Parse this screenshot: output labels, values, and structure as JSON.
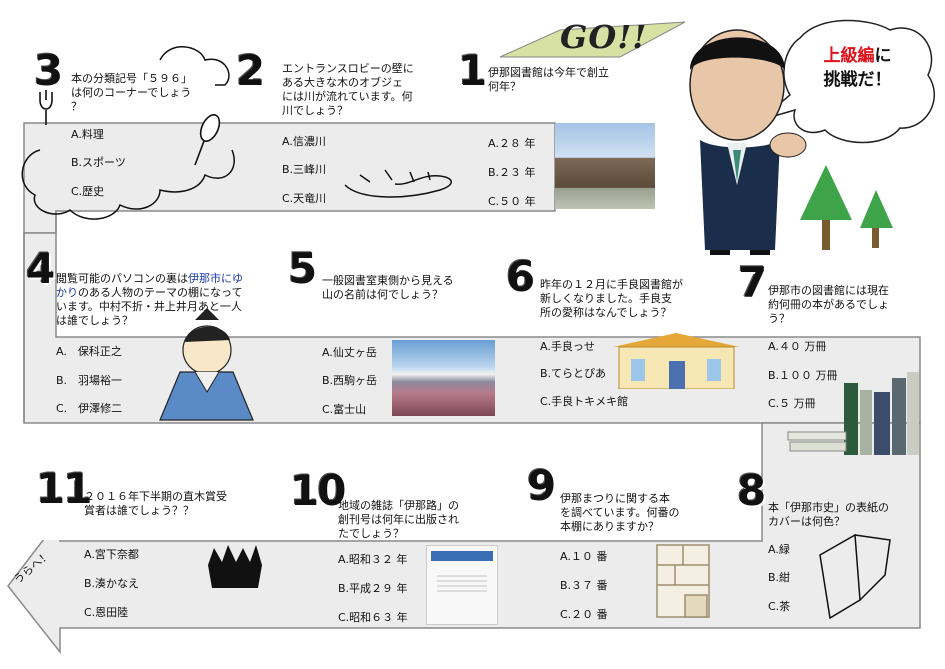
{
  "header": {
    "go": "GO!!",
    "bubble_line1a": "上級編",
    "bubble_line1b": "に",
    "bubble_line2": "挑戦だ！",
    "back_label": "うらへ！"
  },
  "q1": {
    "num": "1",
    "text_l1": "伊那図書館は今年で創立",
    "text_l2": "何年？",
    "a": "A.２８ 年",
    "b": "B.２３ 年",
    "c": "C.５０ 年"
  },
  "q2": {
    "num": "2",
    "text_l1": "エントランスロビーの壁に",
    "text_l2": "ある大きな木のオブジェ",
    "text_l3": "には川が流れています。何",
    "text_l4": "川でしょう？",
    "a": "A.信濃川",
    "b": "B.三峰川",
    "c": "C.天竜川"
  },
  "q3": {
    "num": "3",
    "text_l1": "本の分類記号「５９６」",
    "text_l2": "は何のコーナーでしょう",
    "text_l3": "？",
    "a": "A.料理",
    "b": "B.スポーツ",
    "c": "C.歴史"
  },
  "q4": {
    "num": "4",
    "text_l1a": "閲覧可能のパソコンの裏は",
    "text_l1b": "伊那市にゆ",
    "text_l2a": "かり",
    "text_l2b": "のある人物のテーマの棚になって",
    "text_l3": "います。中村不折・井上井月あと一人",
    "text_l4": "は誰でしょう？",
    "a": "A.　保科正之",
    "b": "B.　羽場裕一",
    "c": "C.　伊澤修二"
  },
  "q5": {
    "num": "5",
    "text_l1": "一般図書室東側から見える",
    "text_l2": "山の名前は何でしょう？",
    "a": "A.仙丈ヶ岳",
    "b": "B.西駒ヶ岳",
    "c": "C.富士山"
  },
  "q6": {
    "num": "6",
    "text_l1": "昨年の１２月に手良図書館が",
    "text_l2": "新しくなりました。手良支",
    "text_l3": "所の愛称はなんでしょう？",
    "a": "A.手良っせ",
    "b": "B.てらとぴあ",
    "c": "C.手良トキメキ館"
  },
  "q7": {
    "num": "7",
    "text_l1": "伊那市の図書館には現在",
    "text_l2": "約何冊の本があるでしょ",
    "text_l3": "う？",
    "a": "A.４０ 万冊",
    "b": "B.１００ 万冊",
    "c": "C.５ 万冊"
  },
  "q8": {
    "num": "8",
    "text_l1": "本「伊那市史」の表紙の",
    "text_l2": "カバーは何色？",
    "a": "A.緑",
    "b": "B.紺",
    "c": "C.茶"
  },
  "q9": {
    "num": "9",
    "text_l1": "伊那まつりに関する本",
    "text_l2": "を調べています。何番の",
    "text_l3": "本棚にありますか？",
    "a": "A.１０ 番",
    "b": "B.３７ 番",
    "c": "C.２０ 番"
  },
  "q10": {
    "num": "10",
    "text_l1": "地域の雑誌「伊那路」の",
    "text_l2": "創刊号は何年に出版され",
    "text_l3": "たでしょう？",
    "a": "A.昭和３２ 年",
    "b": "B.平成２９ 年",
    "c": "C.昭和６３ 年",
    "mag": "伊那路"
  },
  "q11": {
    "num": "11",
    "text_l1": "２０１６年下半期の直木賞受",
    "text_l2": "賞者は誰でしょう？？",
    "a": "A.宮下奈都",
    "b": "B.湊かなえ",
    "c": "C.恩田陸"
  }
}
